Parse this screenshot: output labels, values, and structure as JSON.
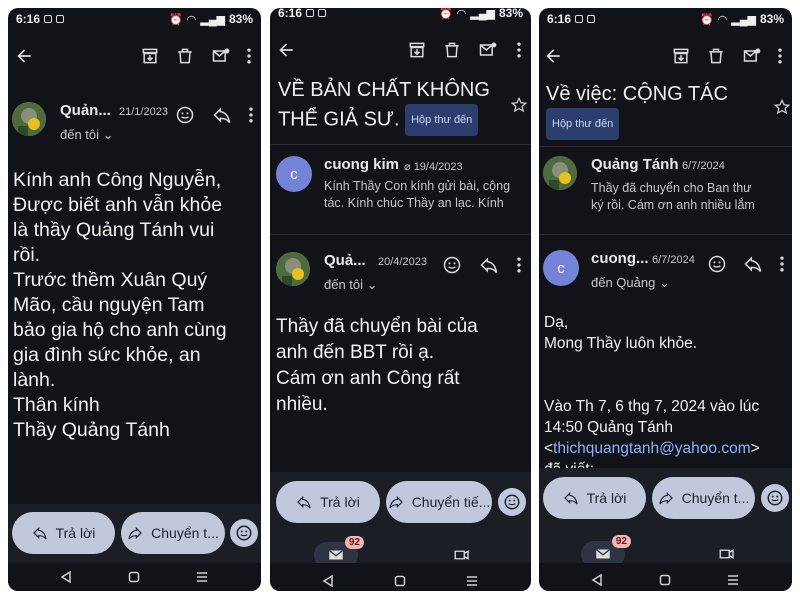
{
  "status": {
    "time": "6:16",
    "battery": "83%"
  },
  "phone1": {
    "sender": "Quản...",
    "date": "21/1/2023",
    "to": "đến tôi",
    "body": [
      "Kính anh Công Nguyễn,",
      "Được biết anh vẫn khỏe",
      "là thầy Quảng Tánh vui",
      "rồi.",
      "Trước thềm Xuân Quý",
      "Mão, cầu nguyện Tam",
      "bảo gia hộ cho anh cùng",
      "gia đình sức khỏe, an",
      "lành.",
      "Thân kính",
      "Thầy Quảng Tánh"
    ],
    "reply_label": "Trả lời",
    "forward_label": "Chuyển t..."
  },
  "phone2": {
    "subject_line1": "VỀ BẢN CHẤT KHÔNG",
    "subject_line2": "THỂ GIẢ SƯ.",
    "label_badge": "Hộp thư đến",
    "msg1": {
      "avatar_letter": "c",
      "sender": "cuong kim",
      "date": "19/4/2023",
      "snippet_line1": "Kính Thầy Con kính gửi bài, cộng",
      "snippet_line2": "tác. Kính chúc Thầy an lạc. Kính"
    },
    "msg2": {
      "sender": "Quả...",
      "date": "20/4/2023",
      "to": "đến tôi",
      "body": [
        "Thầy đã chuyển bài của",
        "anh đến BBT rồi ạ.",
        "Cám ơn anh Công rất",
        "nhiều."
      ]
    },
    "reply_label": "Trả lời",
    "forward_label": "Chuyển tiế...",
    "mail_badge": "92"
  },
  "phone3": {
    "subject": "Về việc: CỘNG TÁC",
    "label_badge": "Hộp thư đến",
    "msg1": {
      "sender": "Quảng Tánh",
      "date": "6/7/2024",
      "snippet_line1": "Thầy đã chuyển cho Ban thư",
      "snippet_line2": "ký rồi. Cám ơn anh nhiều lắm"
    },
    "msg2": {
      "avatar_letter": "c",
      "sender": "cuong...",
      "date": "6/7/2024",
      "to": "đến Quảng",
      "body": [
        "Dạ,",
        "Mong Thầy luôn khỏe."
      ],
      "quote_line1": "Vào Th 7, 6 thg 7, 2024 vào lúc",
      "quote_line2": "14:50 Quảng Tánh",
      "quote_email": "thichquangtanh@yahoo.com",
      "quote_line3": "đã viết:"
    },
    "reply_label": "Trả lời",
    "forward_label": "Chuyển t...",
    "mail_badge": "92"
  }
}
